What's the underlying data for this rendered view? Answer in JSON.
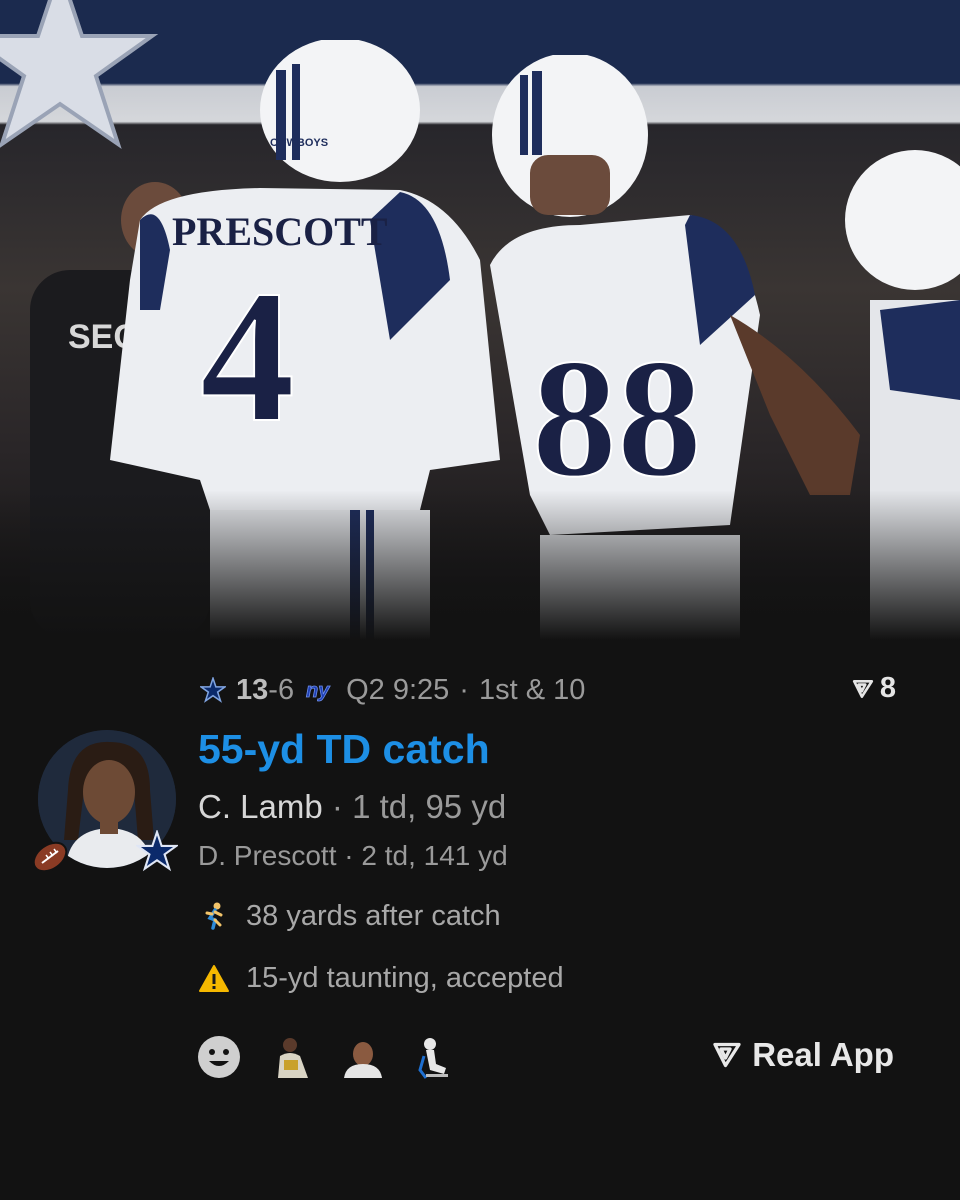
{
  "game": {
    "team_score": "13",
    "opponent_score": "6",
    "opponent_abbr": "ny",
    "quarter": "Q2",
    "clock": "9:25",
    "down_distance": "1st & 10"
  },
  "favorites": {
    "count": "8"
  },
  "play": {
    "headline": "55-yd TD catch",
    "primary_player": {
      "name": "C. Lamb",
      "stats": "1 td, 95 yd"
    },
    "secondary_player": {
      "name": "D. Prescott",
      "stats": "2 td, 141 yd"
    },
    "facts": [
      {
        "icon": "runner-icon",
        "text": "38 yards after catch"
      },
      {
        "icon": "warning-icon",
        "text": "15-yd taunting, accepted"
      }
    ]
  },
  "hero": {
    "jersey_left_name": "PRESCOTT",
    "jersey_left_number": "4",
    "jersey_right_number": "88",
    "helmet_text": "COWBOYS",
    "background_text": "SEC"
  },
  "reactions": [
    "smile-emoji-icon",
    "player-sticker-1",
    "player-sticker-2",
    "player-sticker-3"
  ],
  "brand": {
    "name": "Real App"
  },
  "colors": {
    "accent": "#1d8fe5",
    "team_navy": "#0b2a6b",
    "background": "#121212"
  }
}
